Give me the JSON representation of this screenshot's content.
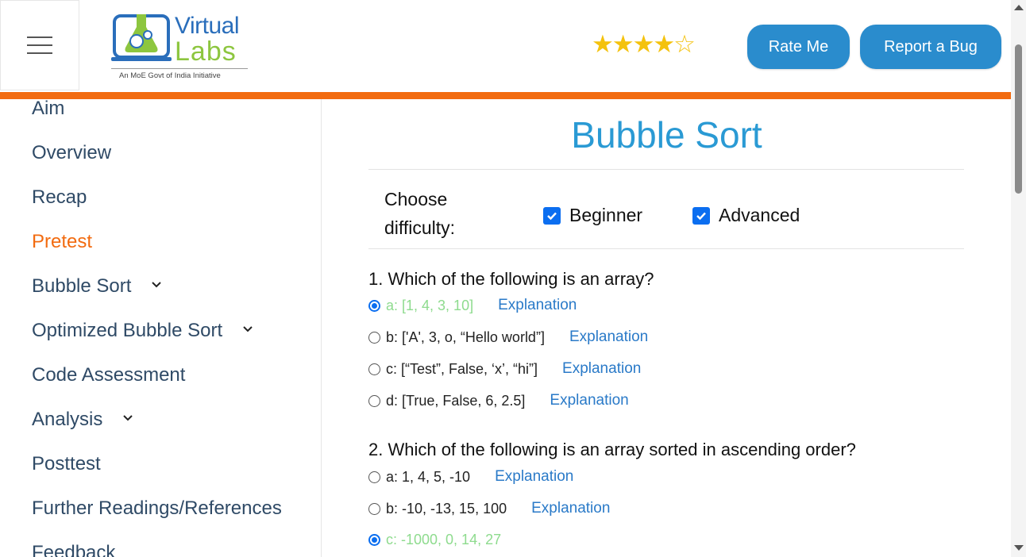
{
  "header": {
    "logo": {
      "word1": "Virtual",
      "word2": "Labs",
      "tagline": "An MoE Govt of India Initiative"
    },
    "rating": {
      "value": 4,
      "max": 5,
      "stars_full": "★★★★",
      "stars_empty": "☆"
    },
    "rate_button": "Rate Me",
    "bug_button": "Report a Bug",
    "accent_color": "#f26b10",
    "button_color": "#2a8ccd"
  },
  "sidebar": {
    "items": [
      {
        "label": "Aim",
        "active": false,
        "expandable": false
      },
      {
        "label": "Overview",
        "active": false,
        "expandable": false
      },
      {
        "label": "Recap",
        "active": false,
        "expandable": false
      },
      {
        "label": "Pretest",
        "active": true,
        "expandable": false
      },
      {
        "label": "Bubble Sort",
        "active": false,
        "expandable": true
      },
      {
        "label": "Optimized Bubble Sort",
        "active": false,
        "expandable": true
      },
      {
        "label": "Code Assessment",
        "active": false,
        "expandable": false
      },
      {
        "label": "Analysis",
        "active": false,
        "expandable": true
      },
      {
        "label": "Posttest",
        "active": false,
        "expandable": false
      },
      {
        "label": "Further Readings/References",
        "active": false,
        "expandable": false
      },
      {
        "label": "Feedback",
        "active": false,
        "expandable": false
      }
    ]
  },
  "main": {
    "title": "Bubble Sort",
    "difficulty": {
      "label_line1": "Choose",
      "label_line2": "difficulty:",
      "beginner": {
        "label": "Beginner",
        "checked": true
      },
      "advanced": {
        "label": "Advanced",
        "checked": true
      }
    },
    "explanation_label": "Explanation",
    "questions": [
      {
        "text": "1. Which of the following is an array?",
        "options": [
          {
            "text": "a: [1, 4, 3, 10]",
            "checked": true,
            "correct": true
          },
          {
            "text": "b: ['A', 3, o, “Hello world”]",
            "checked": false,
            "correct": false
          },
          {
            "text": "c: [“Test”, False, ‘x’, “hi”]",
            "checked": false,
            "correct": false
          },
          {
            "text": "d: [True, False, 6, 2.5]",
            "checked": false,
            "correct": false
          }
        ]
      },
      {
        "text": "2. Which of the following is an array sorted in ascending order?",
        "options": [
          {
            "text": "a: 1, 4, 5, -10",
            "checked": false,
            "correct": false
          },
          {
            "text": "b: -10, -13, 15, 100",
            "checked": false,
            "correct": false
          },
          {
            "text": "c: -1000, 0, 14, 27",
            "checked": true,
            "correct": true
          }
        ]
      }
    ]
  }
}
